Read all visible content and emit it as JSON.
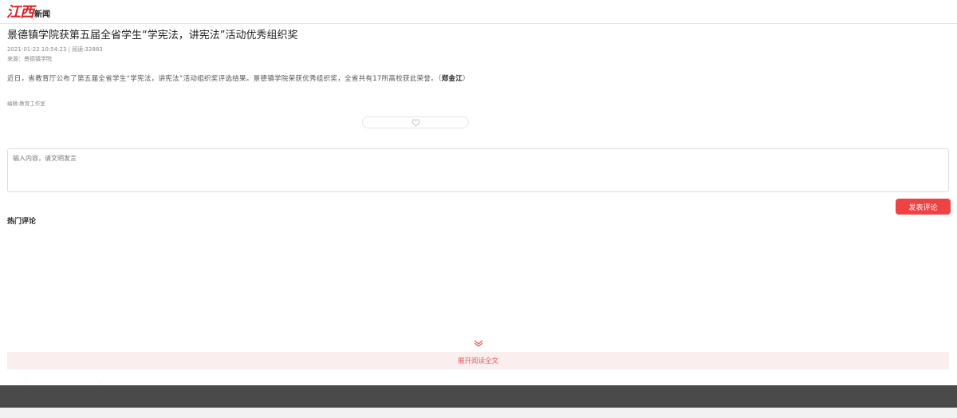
{
  "header": {
    "logo_brand": "江西",
    "logo_sub": "新闻"
  },
  "article": {
    "title": "景德镇学院获第五届全省学生“学宪法，讲宪法”活动优秀组织奖",
    "date_reads": "2021-01-22 10:54:23 | 阅读:32883",
    "source": "来源：景德镇学院",
    "body": "近日，省教育厅公布了第五届全省学生“学宪法，讲宪法”活动组织奖评选结果。景德镇学院荣获优秀组织奖，全省共有17所高校获此荣誉。（",
    "author": "郑金江",
    "body_end": "）",
    "editor": "编辑:教育工作室"
  },
  "comments": {
    "placeholder": "输入内容，请文明发言",
    "submit_label": "发表评论",
    "hot_title": "热门评论"
  },
  "expand": {
    "label": "展开阅读全文"
  },
  "icons": {
    "like": "heart-icon",
    "expand": "chevron-down-icon"
  },
  "colors": {
    "brand": "#d8232a",
    "submit": "#ef4343",
    "expand_bg": "#fbeeee",
    "expand_text": "#e15a5a",
    "footer": "#4a4a4a"
  }
}
